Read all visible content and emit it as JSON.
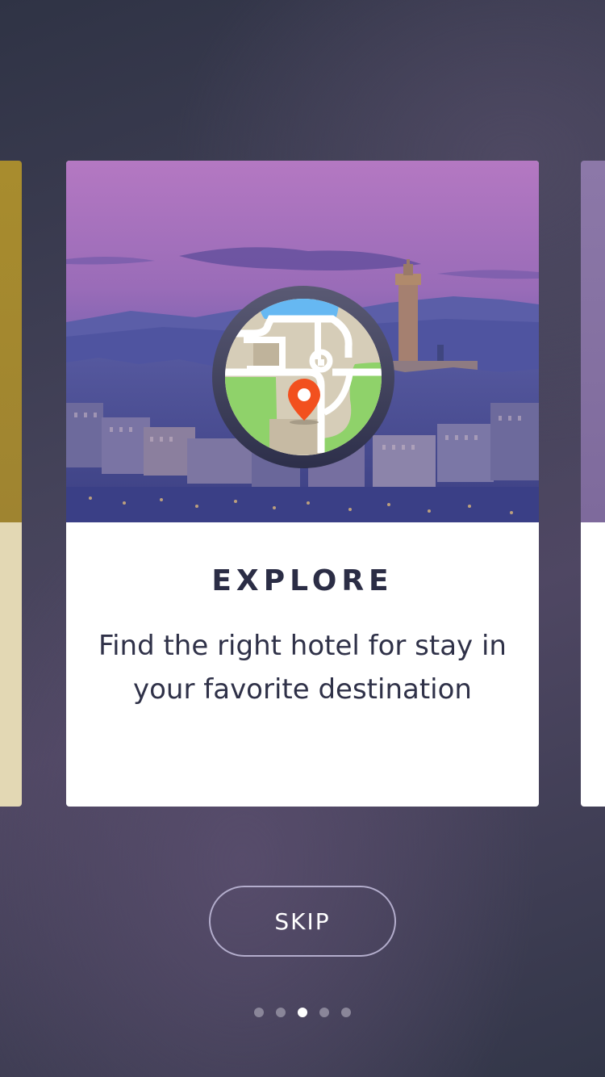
{
  "card": {
    "title": "EXPLORE",
    "description": "Find the right hotel for stay in your favorite destination",
    "icon": "map-pin-icon"
  },
  "skip": {
    "label": "SKIP"
  },
  "pagination": {
    "total": 5,
    "active_index": 2
  },
  "colors": {
    "accent_pin": "#f2501e",
    "title_text": "#2b2d45",
    "left_card": "#a88c2e",
    "right_card": "#8c78a8"
  }
}
